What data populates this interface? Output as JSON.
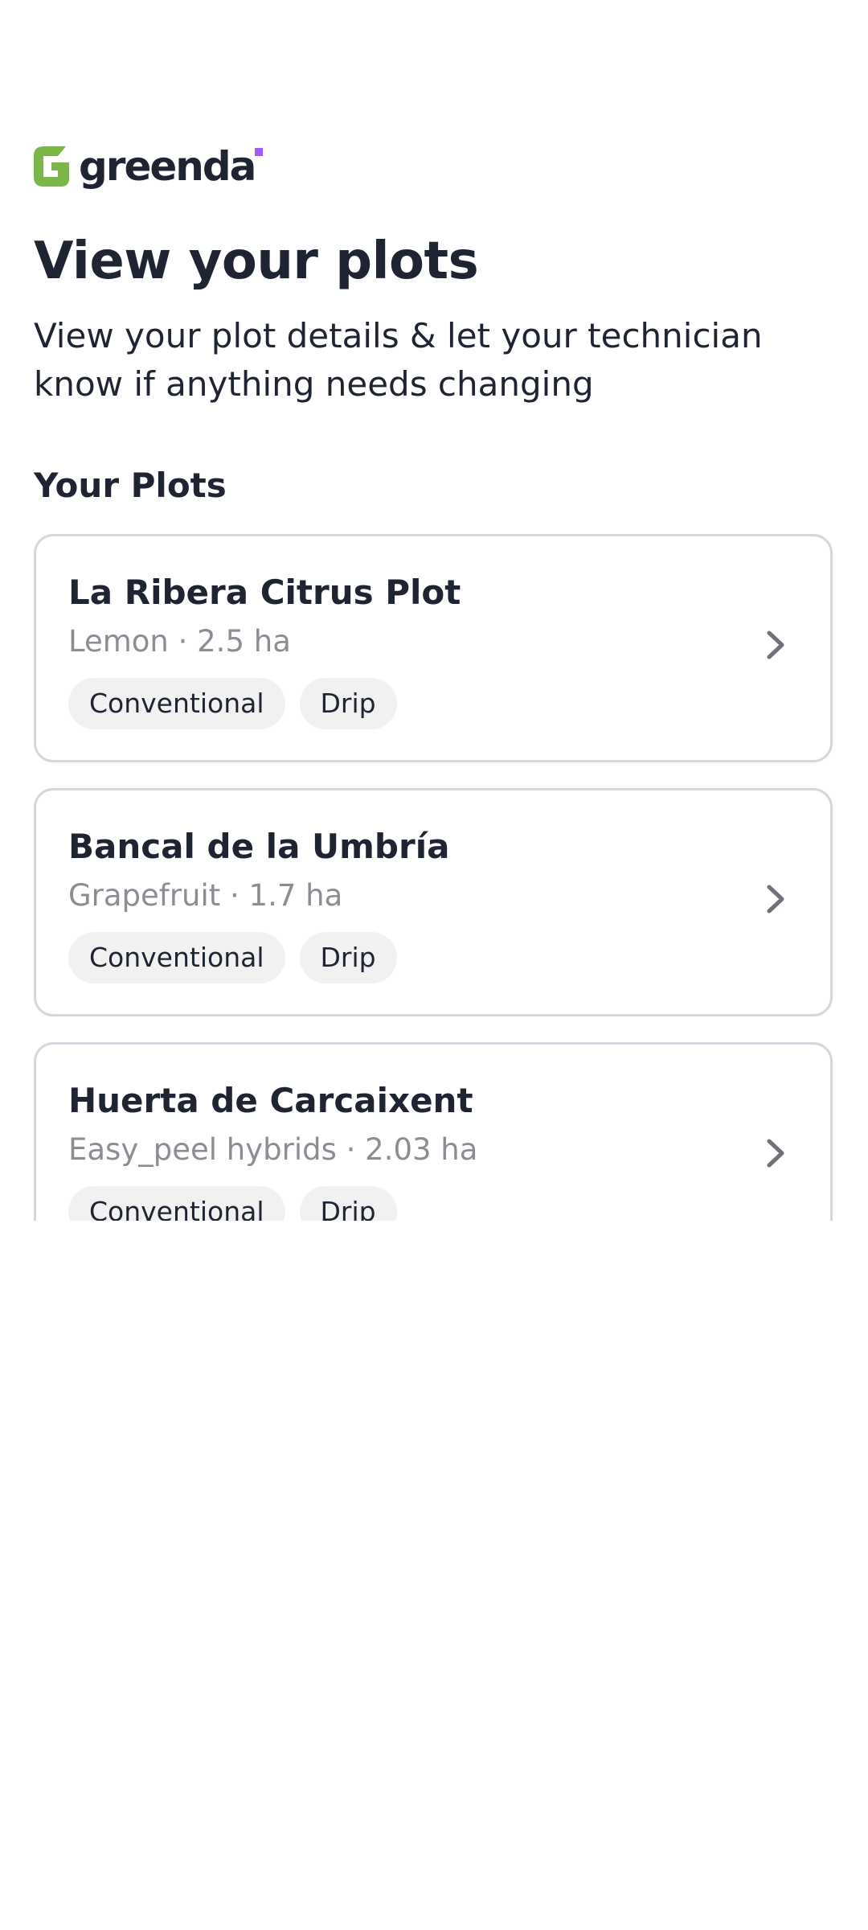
{
  "brand": {
    "name": "greenda",
    "mark_color": "#7ab648",
    "dot_color": "#a35cf5"
  },
  "header": {
    "title": "View your plots",
    "subtitle": "View your plot details & let your technician know if anything needs changing"
  },
  "plots_section": {
    "title": "Your Plots",
    "plots": [
      {
        "name": "La Ribera Citrus Plot",
        "meta": "Lemon · 2.5 ha",
        "tags": [
          "Conventional",
          "Drip"
        ]
      },
      {
        "name": "Bancal de la Umbría",
        "meta": "Grapefruit · 1.7 ha",
        "tags": [
          "Conventional",
          "Drip"
        ]
      },
      {
        "name": "Huerta de Carcaixent",
        "meta": "Easy_peel hybrids · 2.03 ha",
        "tags": [
          "Conventional",
          "Drip"
        ]
      }
    ]
  },
  "icons": {
    "card_action": "chevron-right-icon"
  },
  "colors": {
    "text_primary": "#1f2433",
    "text_secondary": "#8a8d94",
    "card_border": "#d3d7de",
    "tag_background": "#f1f1f2"
  }
}
